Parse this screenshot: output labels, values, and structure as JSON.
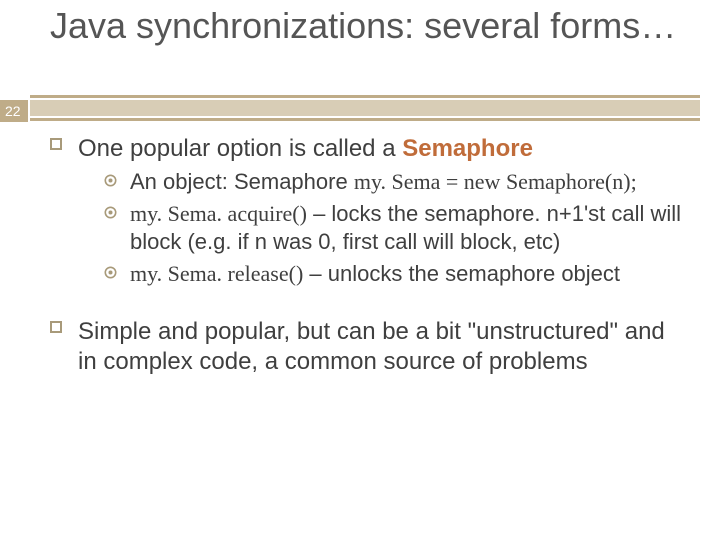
{
  "slide_number": "22",
  "title": "Java synchronizations: several forms…",
  "point1": {
    "prefix": "One popular option is called a ",
    "highlight": "Semaphore",
    "sub": [
      {
        "t1": "An",
        "t2": " object: Semaphore ",
        "code1": "my. Sema = new Semaphore(n);"
      },
      {
        "code1": "my. Sema. acquire()",
        "t2": " – locks the semaphore.  n+1'st call will block (e.g. if n was 0, first call will block, etc)"
      },
      {
        "code1": "my. Sema. release()",
        "t2": " – unlocks the semaphore object"
      }
    ]
  },
  "point2": "Simple and popular, but can be a bit \"unstructured\" and in complex code, a common source of problems"
}
